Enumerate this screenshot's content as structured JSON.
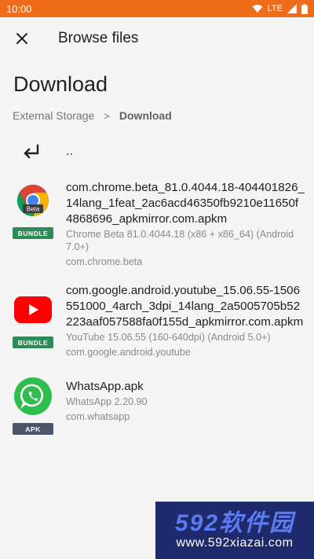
{
  "status_bar": {
    "time": "10:00",
    "network": "LTE",
    "colors": {
      "background": "#ef6c1a"
    }
  },
  "app_bar": {
    "title": "Browse files",
    "close_icon": "close-icon"
  },
  "page_title": "Download",
  "breadcrumb": {
    "items": [
      "External Storage",
      "Download"
    ],
    "separator": ">"
  },
  "parent_directory": {
    "label": "..",
    "icon": "return-arrow-icon"
  },
  "files": [
    {
      "name": "com.chrome.beta_81.0.4044.18-404401826_14lang_1feat_2ac6acd46350fb9210e11650f4868696_apkmirror.com.apkm",
      "description": "Chrome Beta 81.0.4044.18 (x86 + x86_64) (Android 7.0+)",
      "package": "com.chrome.beta",
      "badge": "BUNDLE",
      "icon": "chrome-beta-icon",
      "icon_text": "Beta"
    },
    {
      "name": "com.google.android.youtube_15.06.55-1506551000_4arch_3dpi_14lang_2a5005705b52223aaf057588fa0f155d_apkmirror.com.apkm",
      "description": "YouTube 15.06.55 (160-640dpi) (Android 5.0+)",
      "package": "com.google.android.youtube",
      "badge": "BUNDLE",
      "icon": "youtube-icon"
    },
    {
      "name": "WhatsApp.apk",
      "description": "WhatsApp 2.20.90",
      "package": "com.whatsapp",
      "badge": "APK",
      "icon": "whatsapp-icon"
    }
  ],
  "watermark": {
    "brand": "592软件园",
    "url": "www.592xiazai.com"
  }
}
